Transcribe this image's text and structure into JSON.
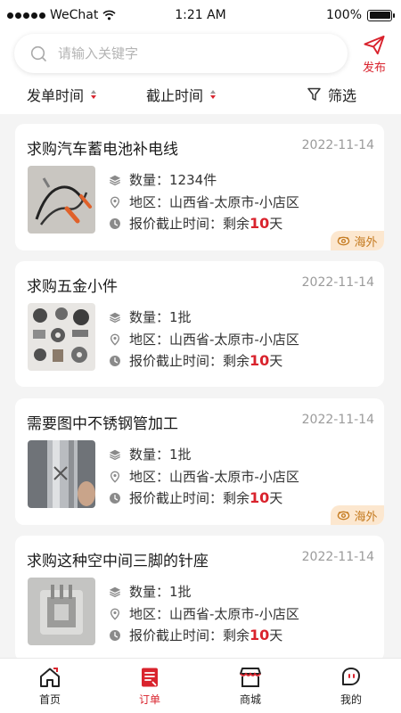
{
  "status_bar": {
    "carrier": "WeChat",
    "time": "1:21 AM",
    "battery": "100%"
  },
  "search": {
    "placeholder": "请输入关键字"
  },
  "publish": {
    "label": "发布"
  },
  "filters": {
    "send_time": "发单时间",
    "deadline": "截止时间",
    "filter": "筛选"
  },
  "labels": {
    "quantity": "数量：",
    "region": "地区：",
    "deadline_prefix": "报价截止时间：",
    "remaining": "剩余",
    "days_unit": "天"
  },
  "cards": [
    {
      "title": "求购汽车蓄电池补电线",
      "date": "2022-11-14",
      "quantity": "1234件",
      "region": "山西省-太原市-小店区",
      "days": "10",
      "badge": "海外"
    },
    {
      "title": "求购五金小件",
      "date": "2022-11-14",
      "quantity": "1批",
      "region": "山西省-太原市-小店区",
      "days": "10",
      "badge": ""
    },
    {
      "title": "需要图中不锈钢管加工",
      "date": "2022-11-14",
      "quantity": "1批",
      "region": "山西省-太原市-小店区",
      "days": "10",
      "badge": "海外"
    },
    {
      "title": "求购这种空中间三脚的针座",
      "date": "2022-11-14",
      "quantity": "1批",
      "region": "山西省-太原市-小店区",
      "days": "10",
      "badge": ""
    }
  ],
  "tabs": [
    {
      "label": "首页",
      "icon": "home-icon"
    },
    {
      "label": "订单",
      "icon": "order-icon"
    },
    {
      "label": "商城",
      "icon": "store-icon"
    },
    {
      "label": "我的",
      "icon": "profile-icon"
    }
  ],
  "colors": {
    "accent": "#d9232d",
    "badge_bg": "#fce7cf",
    "badge_text": "#c47a1f",
    "background": "#f4f4f4"
  }
}
